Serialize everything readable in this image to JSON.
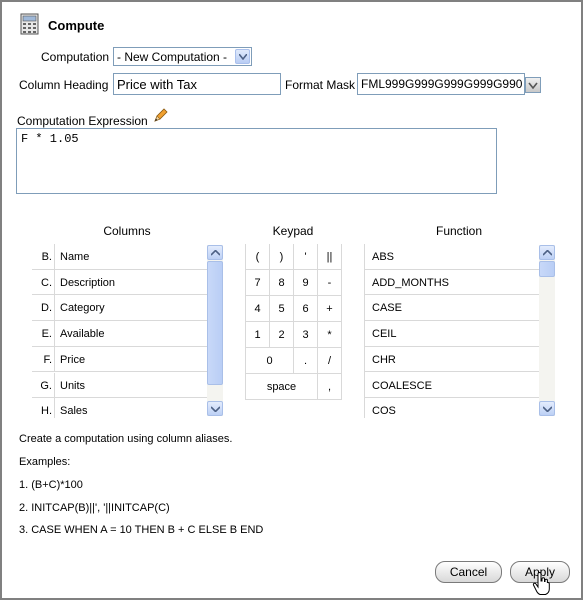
{
  "dialog": {
    "title": "Compute",
    "title_icon": "calculator-icon"
  },
  "form": {
    "computation_label": "Computation",
    "computation_value": "- New Computation -",
    "heading_label": "Column Heading",
    "heading_value": "Price with Tax",
    "format_label": "Format Mask",
    "format_value": "FML999G999G999G999G990",
    "expression_label": "Computation Expression",
    "expression_icon": "pencil-icon",
    "expression_value": "F * 1.05"
  },
  "columns": {
    "header": "Columns",
    "items": [
      {
        "letter": "B.",
        "name": "Name"
      },
      {
        "letter": "C.",
        "name": "Description"
      },
      {
        "letter": "D.",
        "name": "Category"
      },
      {
        "letter": "E.",
        "name": "Available"
      },
      {
        "letter": "F.",
        "name": "Price"
      },
      {
        "letter": "G.",
        "name": "Units"
      },
      {
        "letter": "H.",
        "name": "Sales"
      }
    ]
  },
  "keypad": {
    "header": "Keypad",
    "keys": [
      "(",
      ")",
      "'",
      "||",
      "7",
      "8",
      "9",
      "-",
      "4",
      "5",
      "6",
      "+",
      "1",
      "2",
      "3",
      "*",
      "0",
      ".",
      "/",
      "space",
      ","
    ]
  },
  "functions": {
    "header": "Function",
    "items": [
      "ABS",
      "ADD_MONTHS",
      "CASE",
      "CEIL",
      "CHR",
      "COALESCE",
      "COS"
    ]
  },
  "help": {
    "intro": "Create a computation using column aliases.",
    "examples_label": "Examples:",
    "examples": [
      "1. (B+C)*100",
      "2. INITCAP(B)||', '||INITCAP(C)",
      "3. CASE WHEN A = 10 THEN B + C ELSE B END"
    ]
  },
  "buttons": {
    "cancel": "Cancel",
    "apply": "Apply"
  },
  "colors": {
    "input_border": "#7f9db9",
    "scroll_blue": "#bcd0f5",
    "frame_border": "#808080"
  }
}
